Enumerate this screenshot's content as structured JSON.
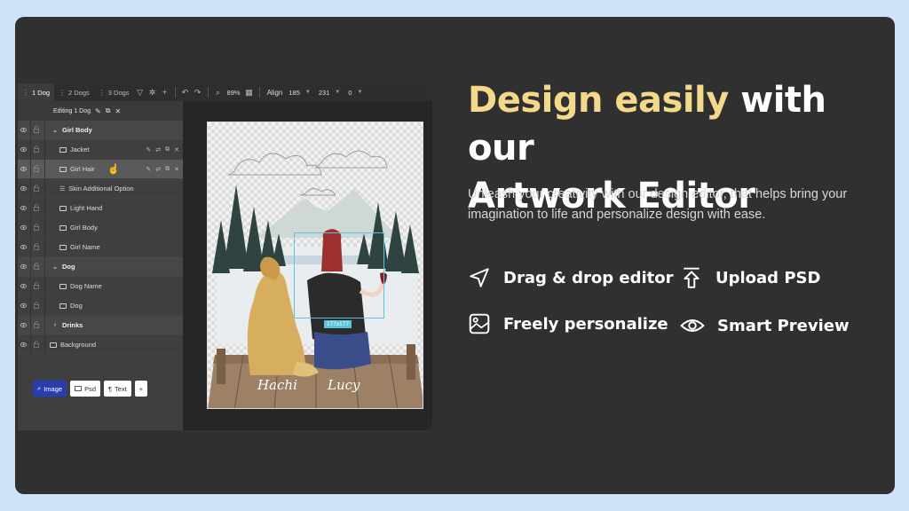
{
  "editor": {
    "tabs": [
      {
        "label": "1 Dog",
        "active": true
      },
      {
        "label": "2 Dogs",
        "active": false
      },
      {
        "label": "3 Dogs",
        "active": false
      }
    ],
    "toolbar": {
      "zoom": "89%",
      "align_label": "Align",
      "x_value": "185",
      "y_value": "231",
      "rotation_value": "0"
    },
    "editing_label": "Editing 1 Dog",
    "layers": [
      {
        "label": "Girl Body",
        "type": "group",
        "expanded": true
      },
      {
        "label": "Jacket",
        "type": "image"
      },
      {
        "label": "Girl Hair",
        "type": "image",
        "selected": true
      },
      {
        "label": "Skin Additional Option",
        "type": "option"
      },
      {
        "label": "Light Hand",
        "type": "image"
      },
      {
        "label": "Girl Body",
        "type": "image"
      },
      {
        "label": "Girl Name",
        "type": "text"
      },
      {
        "label": "Dog",
        "type": "group",
        "expanded": true
      },
      {
        "label": "Dog Name",
        "type": "text"
      },
      {
        "label": "Dog",
        "type": "image"
      },
      {
        "label": "Drinks",
        "type": "group",
        "expanded": false
      },
      {
        "label": "Background",
        "type": "image"
      }
    ],
    "add_buttons": {
      "image": "Image",
      "psd": "Psd",
      "text": "Text",
      "plus": "+"
    },
    "canvas": {
      "dog_name": "Hachi",
      "girl_name": "Lucy",
      "selection_size": "177x177"
    }
  },
  "marketing": {
    "headline_highlight": "Design easily",
    "headline_rest_1": " with our",
    "headline_rest_2": "Artwork Editor",
    "description": "Unleash your creativity with our design editor, that helps bring your imagination to life and personalize design with ease.",
    "features": [
      {
        "label": "Drag & drop editor",
        "icon": "navigation-arrow-icon"
      },
      {
        "label": "Upload PSD",
        "icon": "upload-icon"
      },
      {
        "label": "Freely personalize",
        "icon": "image-edit-icon"
      },
      {
        "label": "Smart Preview",
        "icon": "eye-icon"
      }
    ]
  },
  "colors": {
    "page_bg": "#cfe3f8",
    "card_bg": "#303030",
    "highlight": "#f5d98a",
    "primary_button": "#2a3db0",
    "selection": "#56c6d8"
  }
}
